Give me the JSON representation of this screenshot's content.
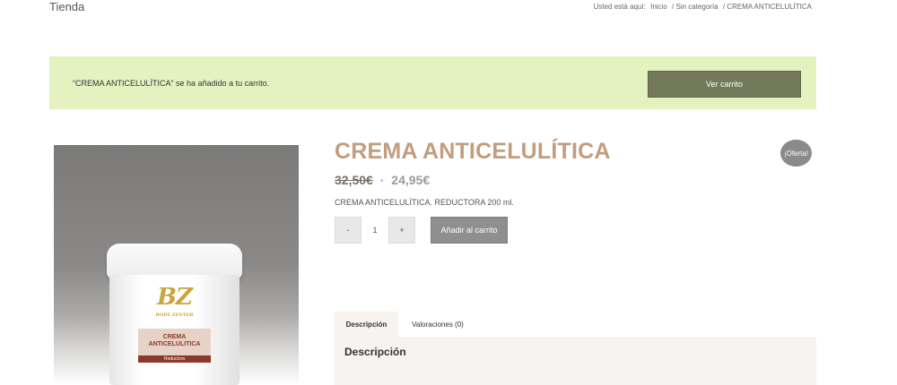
{
  "page": {
    "title": "Tienda"
  },
  "breadcrumb": {
    "prefix": "Usted está aquí:",
    "items": [
      "Inicio",
      "/ Sin categoría",
      "/ CREMA ANTICELULÍTICA"
    ]
  },
  "notice": {
    "message": "“CREMA ANTICELULÍTICA” se ha añadido a tu carrito.",
    "button_label": "Ver carrito"
  },
  "product": {
    "title": "CREMA ANTICELULÍTICA",
    "badge": "¡Oferta!",
    "price_old": "32,50€",
    "price_separator": "·",
    "price_new": "24,95€",
    "short_description": "CREMA ANTICELULÍTICA. REDUCTORA 200 ml.",
    "image": {
      "logo": "BZ",
      "brand": "BODY ZENTER",
      "label_line1": "CREMA",
      "label_line2": "ANTICELULITICA",
      "label_sub": "Reductora"
    }
  },
  "cart_form": {
    "minus_label": "-",
    "quantity": "1",
    "plus_label": "+",
    "add_label": "Añadir al carrito"
  },
  "tabs": {
    "items": [
      {
        "label": "Descripción",
        "active": true
      },
      {
        "label": "Valoraciones (0)",
        "active": false
      }
    ],
    "panel_title": "Descripción"
  },
  "colors": {
    "notice_bg": "#e4f2c0",
    "notice_button": "#737a5c",
    "title": "#c29d7e",
    "badge": "#8a8a8a",
    "add_button": "#8f8f8f"
  }
}
